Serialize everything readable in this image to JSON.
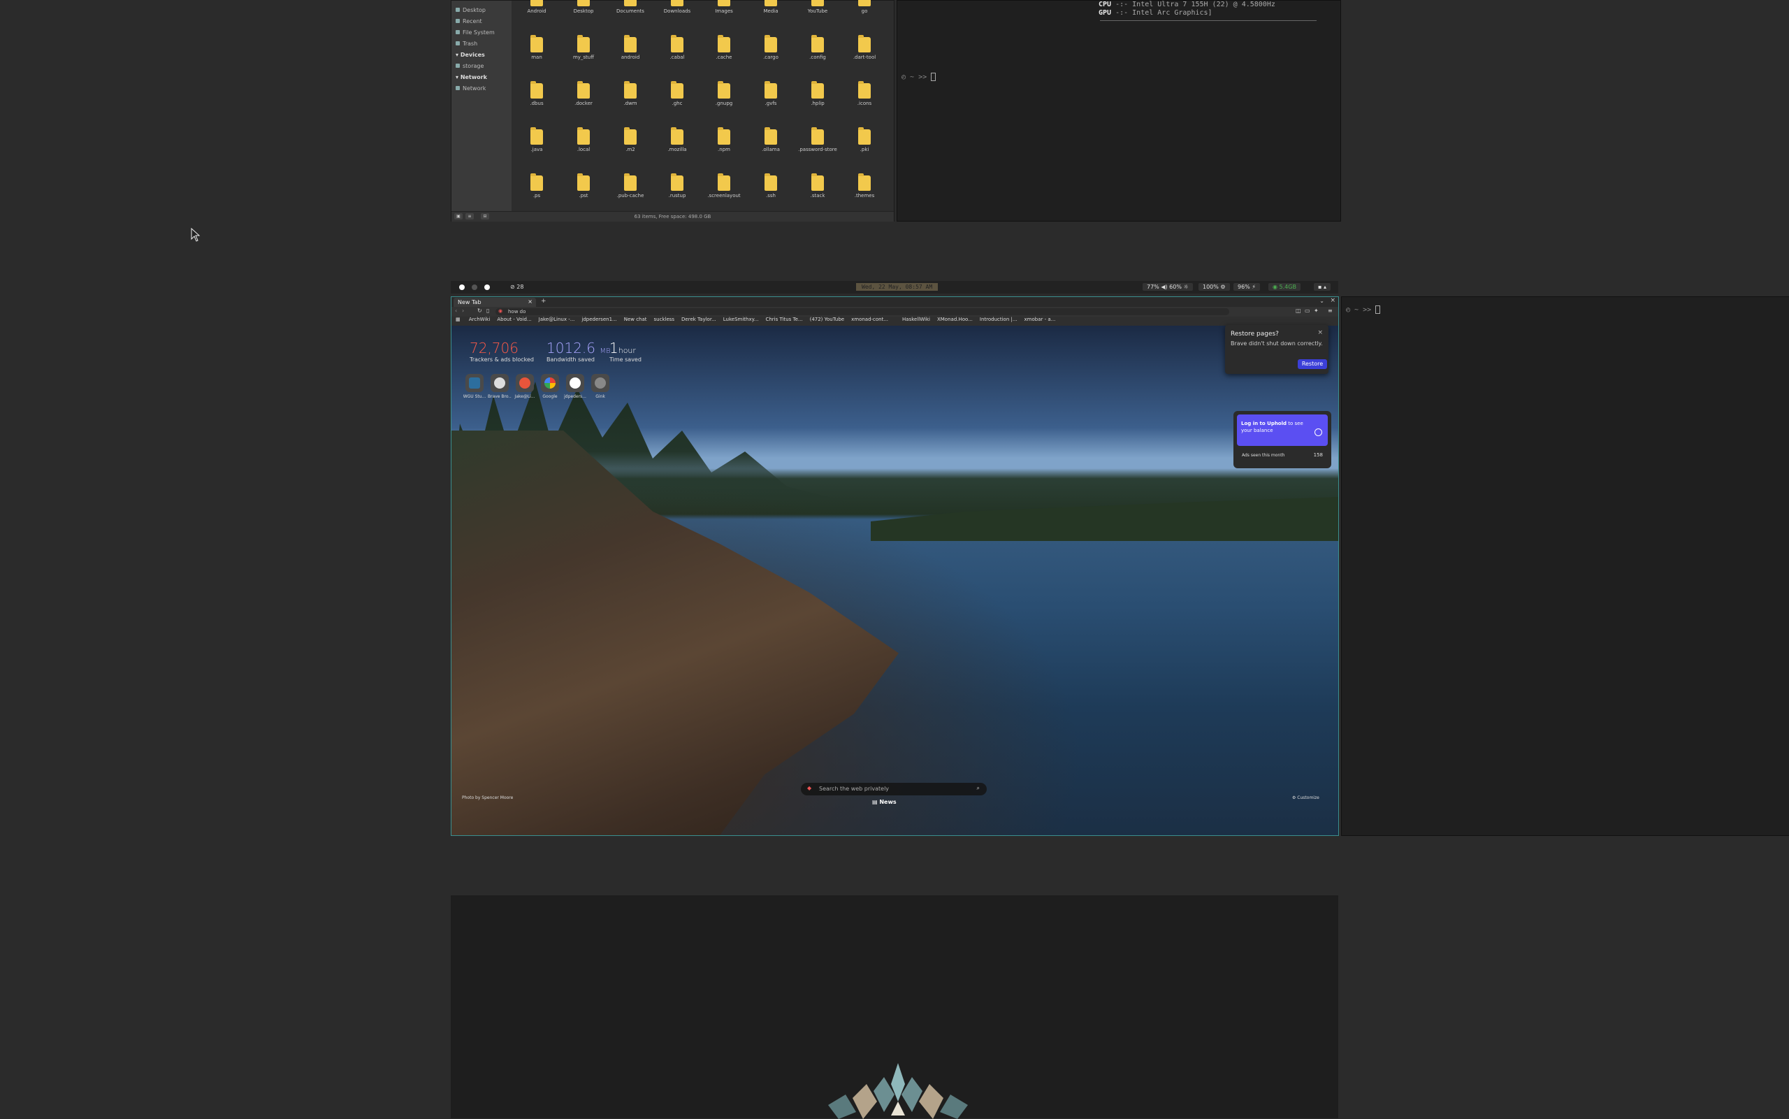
{
  "file_manager": {
    "sidebar": [
      {
        "label": "Desktop",
        "header": false
      },
      {
        "label": "Recent",
        "header": false
      },
      {
        "label": "File System",
        "header": false
      },
      {
        "label": "Trash",
        "header": false
      },
      {
        "label": "Devices",
        "header": true
      },
      {
        "label": "storage",
        "header": false
      },
      {
        "label": "Network",
        "header": true
      },
      {
        "label": "Network",
        "header": false
      }
    ],
    "folders": [
      "Android",
      "Desktop",
      "Documents",
      "Downloads",
      "Images",
      "Media",
      "YouTube",
      "go",
      "man",
      "my_stuff",
      "android",
      ".cabal",
      ".cache",
      ".cargo",
      ".config",
      ".dart-tool",
      ".dbus",
      ".docker",
      ".dwm",
      ".ghc",
      ".gnupg",
      ".gvfs",
      ".hplip",
      ".icons",
      ".java",
      ".local",
      ".m2",
      ".mozilla",
      ".npm",
      ".ollama",
      ".password-store",
      ".pki",
      ".ps",
      ".pst",
      ".pub-cache",
      ".rustup",
      ".screenlayout",
      ".ssh",
      ".stack",
      ".themes"
    ],
    "status": "63 items, Free space: 498.0 GB"
  },
  "terminal_top": {
    "cpu_key": "CPU",
    "cpu_val": " -:- Intel Ultra 7 155H (22) @ 4.5800Hz",
    "gpu_key": "GPU",
    "gpu_val": " -:- Intel Arc Graphics]",
    "prompt": "~ >> "
  },
  "statusbar": {
    "workspace_count": "28",
    "date": "Wed, 22 May, 08:57 AM",
    "volume": "77% ◀) 60% ☼",
    "brightness": "100% ⚙",
    "battery": "96% ⚡",
    "net": "◉ 5.4GB",
    "tray": "▪ ▴"
  },
  "browser": {
    "tab_title": "New Tab",
    "url": "how do",
    "bookmarks": [
      "ArchWiki",
      "About - Void...",
      "Jake@Linux -...",
      "jdpedersen1...",
      "New chat",
      "suckless",
      "Derek Taylor...",
      "LukeSmithxy...",
      "Chris Titus Te...",
      "(472) YouTube",
      "xmonad-cont...",
      "",
      "HaskellWiki",
      "XMonad.Hoo...",
      "Introduction |...",
      "xmobar - a..."
    ],
    "stats": {
      "trackers_value": "72,706",
      "trackers_label": "Trackers & ads blocked",
      "bandwidth_value": "1012.6",
      "bandwidth_unit": "MB",
      "bandwidth_label": "Bandwidth saved",
      "time_value": "1",
      "time_unit": "hour",
      "time_label": "Time saved"
    },
    "top_sites": [
      "WGU Stu...",
      "Brave Bro...",
      "Jake@Li...",
      "Google",
      "jdpeders...",
      "Gink"
    ],
    "restore_popup": {
      "title": "Restore pages?",
      "subtitle": "Brave didn't shut down correctly.",
      "button": "Restore"
    },
    "rewards": {
      "card_text_bold": "Log in to Uphold",
      "card_text": " to see your balance",
      "ads_label": "Ads seen this month",
      "ads_count": "158"
    },
    "search_placeholder": "Search the web privately",
    "news_label": "News",
    "photo_credit": "Photo by Spencer Moore",
    "customize_label": "Customize"
  },
  "colors": {
    "accent": "#3b3fd8",
    "trackers": "#ff5a47",
    "bandwidth": "#a9a6ff",
    "folder": "#f2c94c",
    "focus_border": "#3a8f8f"
  }
}
